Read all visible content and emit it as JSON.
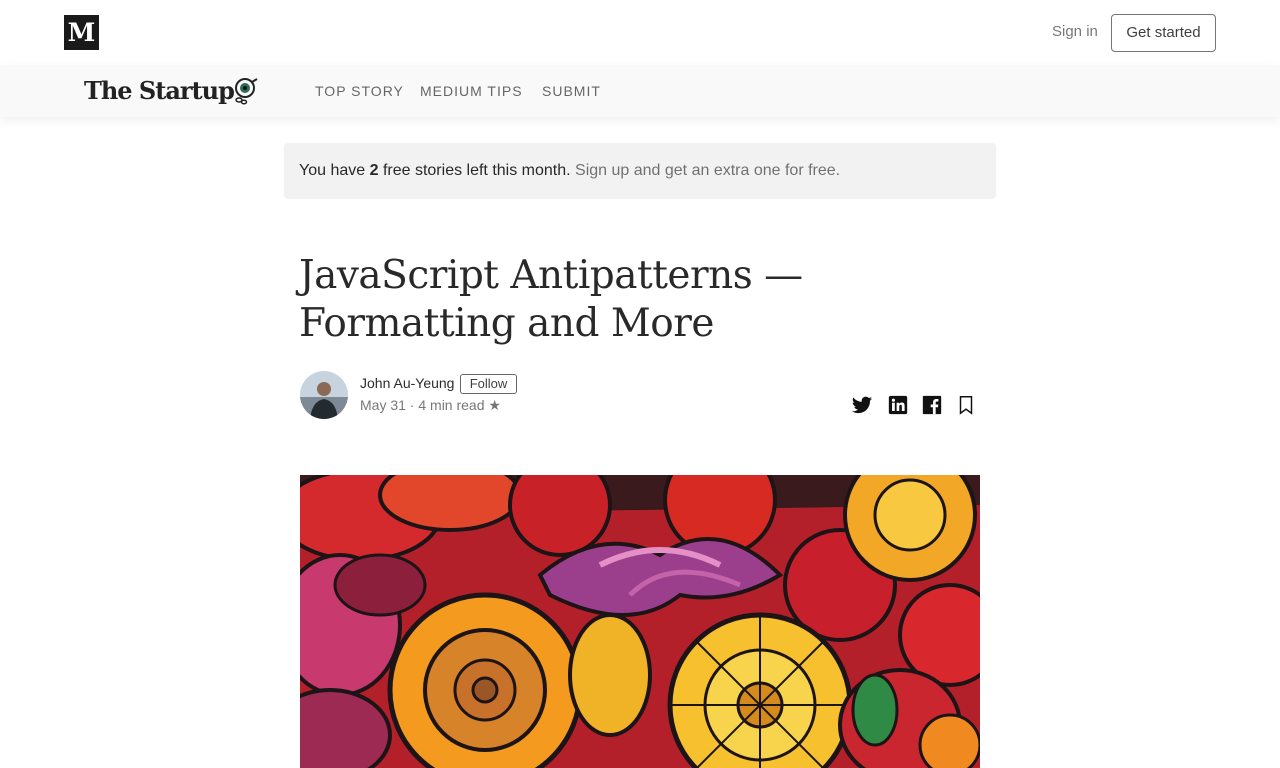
{
  "topbar": {
    "logo_letter": "M",
    "signin_label": "Sign in",
    "getstarted_label": "Get started"
  },
  "publication": {
    "name": "The Startup",
    "nav": [
      "TOP STORY",
      "MEDIUM TIPS",
      "SUBMIT"
    ]
  },
  "notice": {
    "prefix": "You have ",
    "count": "2",
    "suffix": " free stories left this month.",
    "signup": "Sign up and get an extra one for free."
  },
  "article": {
    "title": "JavaScript Antipatterns — Formatting and More",
    "author": "John Au-Yeung",
    "follow_label": "Follow",
    "meta": "May 31 · 4 min read ★"
  },
  "share": {
    "icons": [
      "twitter-icon",
      "linkedin-icon",
      "facebook-icon",
      "bookmark-icon"
    ]
  },
  "colors": {
    "brand_black": "#1a1a1a",
    "pubbar_bg": "#f9f9f9",
    "notice_bg": "#f2f2f2"
  }
}
